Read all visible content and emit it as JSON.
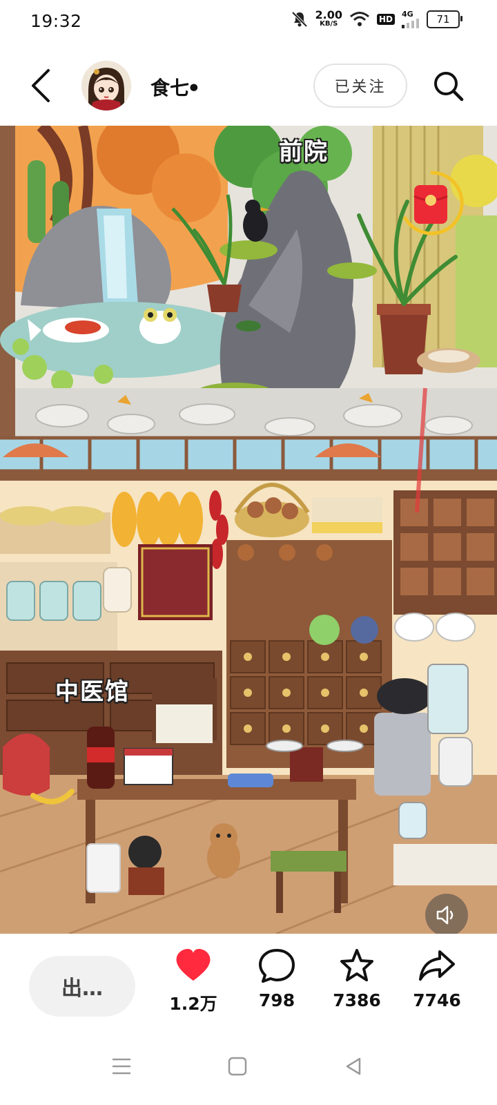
{
  "status_bar": {
    "time": "19:32",
    "net_speed_value": "2.00",
    "net_speed_unit": "KB/S",
    "hd_label": "HD",
    "signal_label": "4G",
    "battery": "71",
    "icons": [
      "mute-icon",
      "wifi-icon",
      "signal-icon",
      "battery-icon"
    ]
  },
  "header": {
    "username": "食七ꔷ",
    "follow_label": "已关注"
  },
  "content": {
    "scene_top_label": "前院",
    "scene_bottom_label": "中医馆"
  },
  "actions": {
    "comment_placeholder": "出…",
    "like_count": "1.2万",
    "comment_count": "798",
    "favorite_count": "7386",
    "share_count": "7746",
    "like_color": "#ff2a3d"
  }
}
